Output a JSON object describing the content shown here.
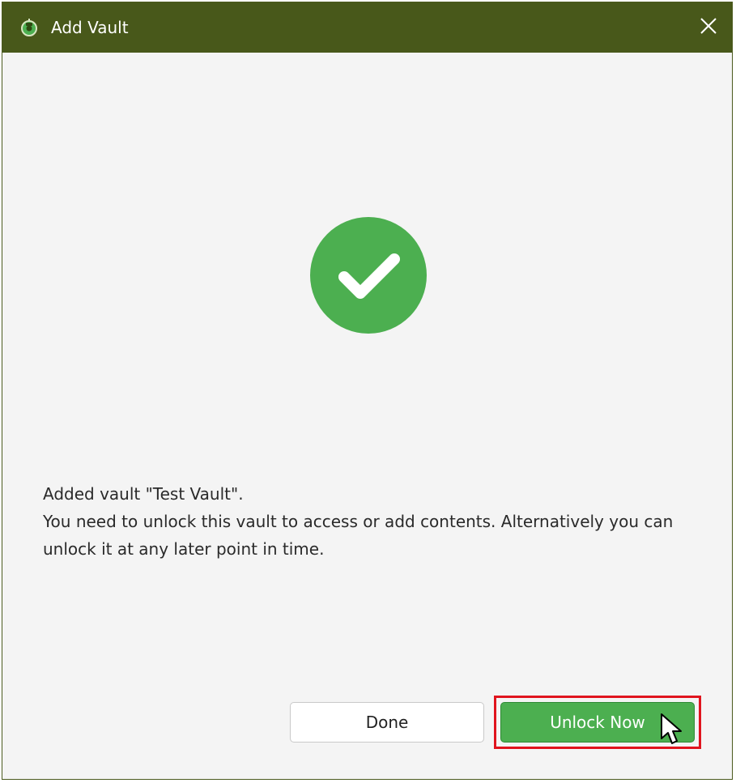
{
  "window": {
    "title": "Add Vault",
    "app_icon": "vault-app-icon",
    "close_icon": "close-icon"
  },
  "status": {
    "icon": "success-check-icon",
    "color": "#4caf50"
  },
  "message": {
    "line1": "Added vault \"Test Vault\".",
    "line2": "You need to unlock this vault to access or add contents. Alternatively you can unlock it at any later point in time."
  },
  "buttons": {
    "done_label": "Done",
    "unlock_label": "Unlock Now"
  },
  "colors": {
    "titlebar": "#48581a",
    "accent": "#4caf50",
    "highlight": "#e0141e"
  }
}
